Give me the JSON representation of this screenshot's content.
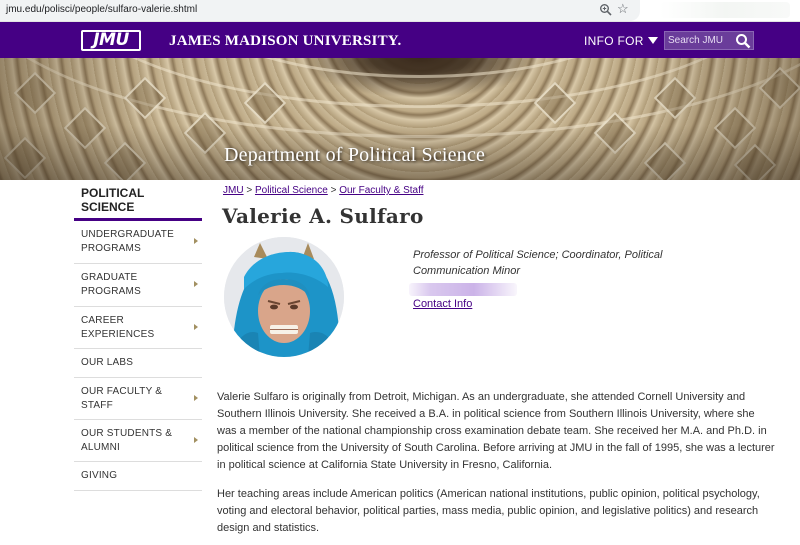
{
  "browser": {
    "url": "jmu.edu/polisci/people/sulfaro-valerie.shtml",
    "zoom_icon": "zoom-icon",
    "bookmark_icon": "star-icon"
  },
  "header": {
    "logo_text": "JMU",
    "university_name": "JAMES MADISON UNIVERSITY.",
    "info_for_label": "INFO FOR",
    "search_placeholder": "Search JMU",
    "brand_color": "#450084"
  },
  "banner": {
    "title": "Department of Political Science"
  },
  "sidebar": {
    "heading": "POLITICAL SCIENCE",
    "accent_color": "#450084",
    "items": [
      {
        "label": "UNDERGRADUATE PROGRAMS",
        "has_arrow": true
      },
      {
        "label": "GRADUATE PROGRAMS",
        "has_arrow": true
      },
      {
        "label": "CAREER EXPERIENCES",
        "has_arrow": true
      },
      {
        "label": "OUR LABS",
        "has_arrow": false
      },
      {
        "label": "OUR FACULTY & STAFF",
        "has_arrow": true
      },
      {
        "label": "OUR STUDENTS & ALUMNI",
        "has_arrow": true
      },
      {
        "label": "GIVING",
        "has_arrow": false
      }
    ]
  },
  "breadcrumb": {
    "items": [
      "JMU",
      "Political Science",
      "Our Faculty & Staff"
    ],
    "separator": ">"
  },
  "profile": {
    "name": "Valerie A. Sulfaro",
    "title": "Professor of Political Science; Coordinator, Political Communication Minor",
    "contact_link": "Contact Info"
  },
  "bio": {
    "paragraphs": [
      "Valerie Sulfaro is originally from Detroit, Michigan. As an undergraduate, she attended Cornell University and Southern Illinois University. She received a B.A. in political science from Southern Illinois University, where she was a member of the national championship cross examination debate team. She received her M.A. and Ph.D. in political science from the University of South Carolina. Before arriving at JMU in the fall of 1995, she was a lecturer in political science at California State University in Fresno, California.",
      "Her teaching areas include American politics (American national institutions, public opinion, political psychology, voting and electoral behavior, political parties, mass media, public opinion, and legislative politics) and research design and statistics."
    ]
  }
}
